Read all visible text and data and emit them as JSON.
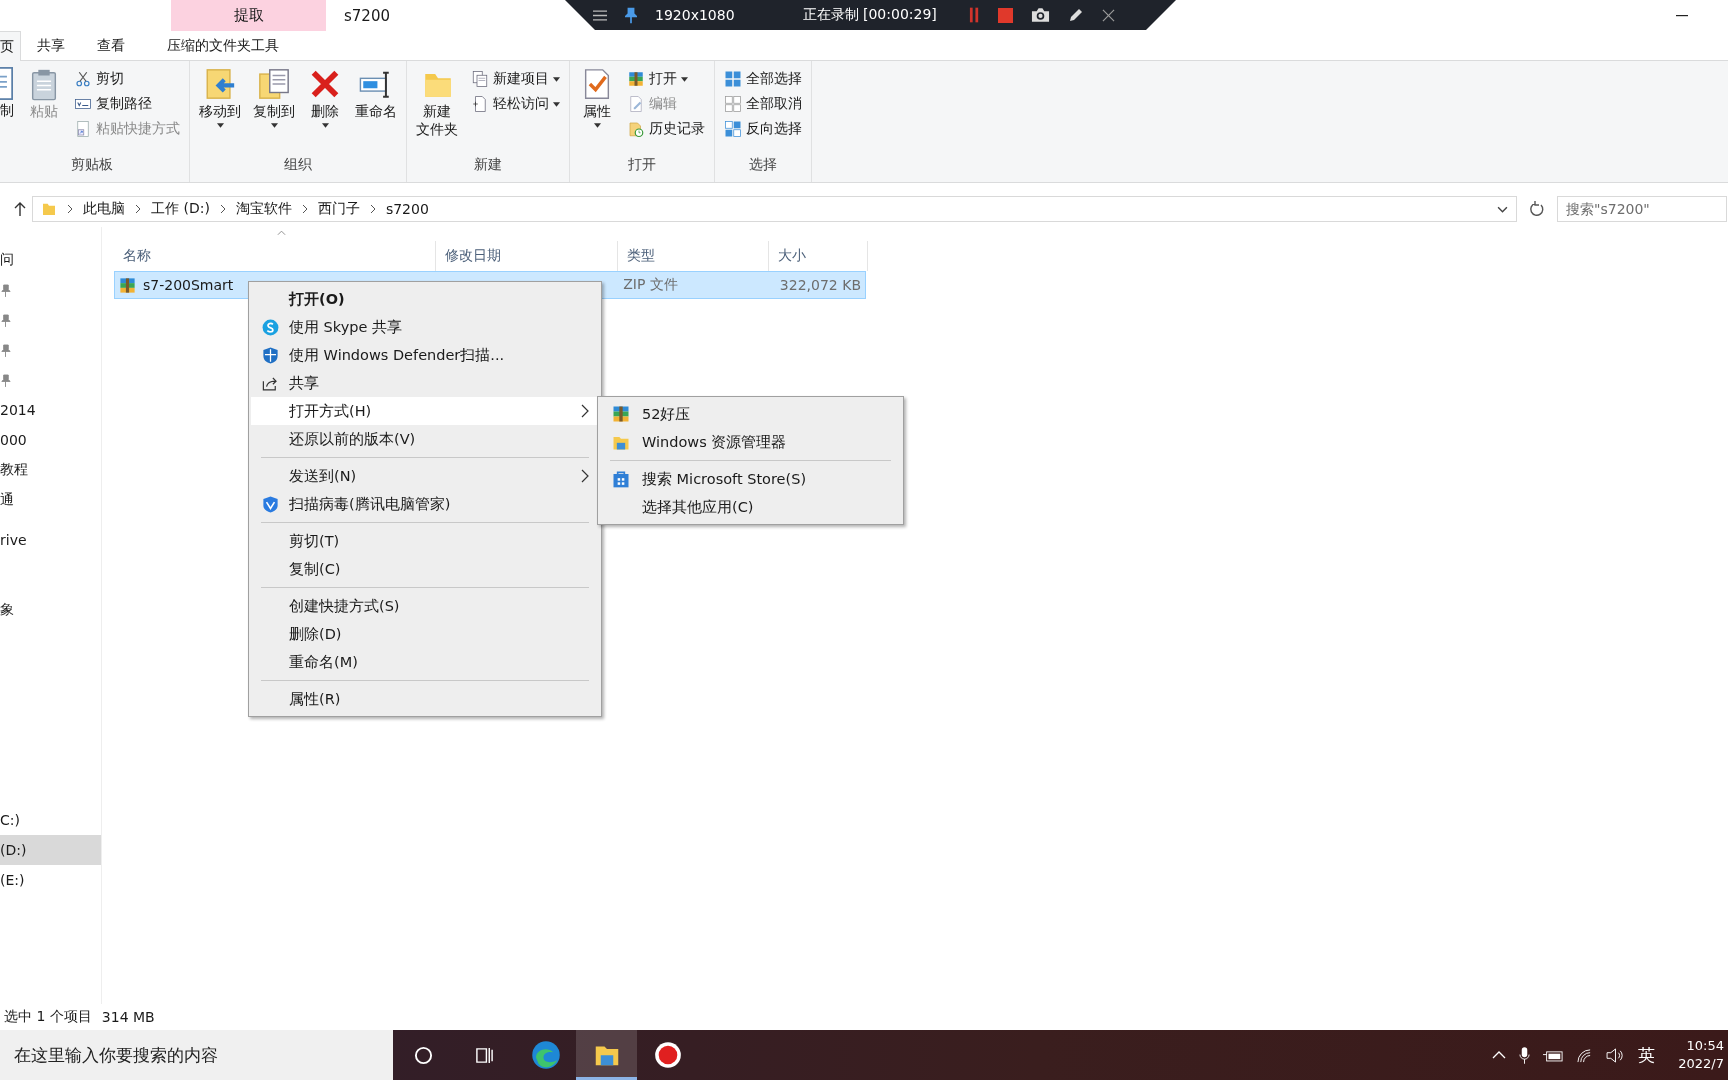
{
  "title_bar": {
    "contextual_tab": "提取",
    "title": "s7200"
  },
  "recorder": {
    "resolution": "1920x1080",
    "status": "正在录制 [00:00:29]"
  },
  "ribbon_tabs": [
    {
      "label": "页",
      "selected": true
    },
    {
      "label": "共享",
      "selected": false
    },
    {
      "label": "查看",
      "selected": false
    },
    {
      "label": "压缩的文件夹工具",
      "selected": false
    }
  ],
  "ribbon_groups": [
    {
      "label": "剪贴板",
      "items": [
        {
          "label": "制",
          "kind": "large",
          "disabled": false,
          "dropdown": false
        },
        {
          "label": "粘贴",
          "kind": "large",
          "disabled": true,
          "dropdown": false
        },
        {
          "label": "剪切",
          "kind": "small",
          "disabled": false,
          "dropdown": false
        },
        {
          "label": "复制路径",
          "kind": "small",
          "disabled": false,
          "dropdown": false
        },
        {
          "label": "粘贴快捷方式",
          "kind": "small",
          "disabled": true,
          "dropdown": false
        }
      ]
    },
    {
      "label": "组织",
      "items": [
        {
          "label": "移动到",
          "kind": "large",
          "disabled": false,
          "dropdown": true
        },
        {
          "label": "复制到",
          "kind": "large",
          "disabled": false,
          "dropdown": true
        },
        {
          "label": "删除",
          "kind": "large",
          "disabled": false,
          "dropdown": true
        },
        {
          "label": "重命名",
          "kind": "large",
          "disabled": false,
          "dropdown": false
        }
      ]
    },
    {
      "label": "新建",
      "items": [
        {
          "label": "新建文件夹",
          "kind": "large",
          "disabled": false,
          "dropdown": false
        },
        {
          "label": "新建项目",
          "kind": "small",
          "disabled": false,
          "dropdown": true
        },
        {
          "label": "轻松访问",
          "kind": "small",
          "disabled": false,
          "dropdown": true
        }
      ]
    },
    {
      "label": "打开",
      "items": [
        {
          "label": "属性",
          "kind": "large",
          "disabled": false,
          "dropdown": true
        },
        {
          "label": "打开",
          "kind": "small",
          "disabled": false,
          "dropdown": true
        },
        {
          "label": "编辑",
          "kind": "small",
          "disabled": true,
          "dropdown": false
        },
        {
          "label": "历史记录",
          "kind": "small",
          "disabled": false,
          "dropdown": false
        }
      ]
    },
    {
      "label": "选择",
      "items": [
        {
          "label": "全部选择",
          "kind": "small",
          "disabled": false,
          "dropdown": false
        },
        {
          "label": "全部取消",
          "kind": "small",
          "disabled": false,
          "dropdown": false
        },
        {
          "label": "反向选择",
          "kind": "small",
          "disabled": false,
          "dropdown": false
        }
      ]
    }
  ],
  "address": {
    "breadcrumb": [
      "此电脑",
      "工作 (D:)",
      "淘宝软件",
      "西门子",
      "s7200"
    ],
    "search_placeholder": "搜索\"s7200\""
  },
  "nav": {
    "sections": [
      [
        {
          "label": "问",
          "pinned": false,
          "selected": false
        },
        {
          "pinned": true,
          "selected": false
        },
        {
          "pinned": true,
          "selected": false
        },
        {
          "pinned": true,
          "selected": false
        },
        {
          "pinned": true,
          "selected": false
        },
        {
          "label": "2014",
          "pinned": false,
          "selected": false
        },
        {
          "label": "000",
          "pinned": false,
          "selected": false
        },
        {
          "label": "教程",
          "pinned": false,
          "selected": false
        },
        {
          "label": "通",
          "pinned": false,
          "selected": false
        }
      ],
      [
        {
          "label": "rive",
          "pinned": false,
          "selected": false
        }
      ],
      [
        {
          "label": "象",
          "pinned": false,
          "selected": false
        }
      ],
      [
        {
          "label": "C:)",
          "pinned": false,
          "selected": false
        },
        {
          "label": "(D:)",
          "pinned": false,
          "selected": true
        },
        {
          "label": "(E:)",
          "pinned": false,
          "selected": false
        }
      ]
    ]
  },
  "table": {
    "columns": [
      "名称",
      "修改日期",
      "类型",
      "大小"
    ],
    "rows": [
      {
        "name": "s7-200Smart",
        "type": "ZIP 文件",
        "size": "322,072 KB",
        "selected": true
      }
    ]
  },
  "context_menu": {
    "items": [
      {
        "kind": "item",
        "label": "打开(O)",
        "default": true,
        "submenu": false,
        "selected": false
      },
      {
        "kind": "item",
        "label": "使用 Skype 共享",
        "default": false,
        "submenu": false,
        "selected": false
      },
      {
        "kind": "item",
        "label": "使用 Windows Defender扫描...",
        "default": false,
        "submenu": false,
        "selected": false
      },
      {
        "kind": "item",
        "label": "共享",
        "default": false,
        "submenu": false,
        "selected": false
      },
      {
        "kind": "item",
        "label": "打开方式(H)",
        "default": false,
        "submenu": true,
        "selected": true
      },
      {
        "kind": "item",
        "label": "还原以前的版本(V)",
        "default": false,
        "submenu": false,
        "selected": false
      },
      {
        "kind": "separator"
      },
      {
        "kind": "item",
        "label": "发送到(N)",
        "default": false,
        "submenu": true,
        "selected": false
      },
      {
        "kind": "item",
        "label": "扫描病毒(腾讯电脑管家)",
        "default": false,
        "submenu": false,
        "selected": false
      },
      {
        "kind": "separator"
      },
      {
        "kind": "item",
        "label": "剪切(T)",
        "default": false,
        "submenu": false,
        "selected": false
      },
      {
        "kind": "item",
        "label": "复制(C)",
        "default": false,
        "submenu": false,
        "selected": false
      },
      {
        "kind": "separator"
      },
      {
        "kind": "item",
        "label": "创建快捷方式(S)",
        "default": false,
        "submenu": false,
        "selected": false
      },
      {
        "kind": "item",
        "label": "删除(D)",
        "default": false,
        "submenu": false,
        "selected": false
      },
      {
        "kind": "item",
        "label": "重命名(M)",
        "default": false,
        "submenu": false,
        "selected": false
      },
      {
        "kind": "separator"
      },
      {
        "kind": "item",
        "label": "属性(R)",
        "default": false,
        "submenu": false,
        "selected": false
      }
    ]
  },
  "submenu": {
    "items": [
      {
        "kind": "item",
        "label": "52好压",
        "selected": false
      },
      {
        "kind": "item",
        "label": "Windows 资源管理器",
        "selected": false
      },
      {
        "kind": "separator"
      },
      {
        "kind": "item",
        "label": "搜索 Microsoft Store(S)",
        "selected": false
      },
      {
        "kind": "item",
        "label": "选择其他应用(C)",
        "selected": false
      }
    ]
  },
  "status_bar": {
    "selection": "选中 1 个项目",
    "size": "314 MB"
  },
  "taskbar": {
    "search_placeholder": "在这里输入你要搜索的内容",
    "ime": "英",
    "time": "10:54",
    "date": "2022/7"
  }
}
